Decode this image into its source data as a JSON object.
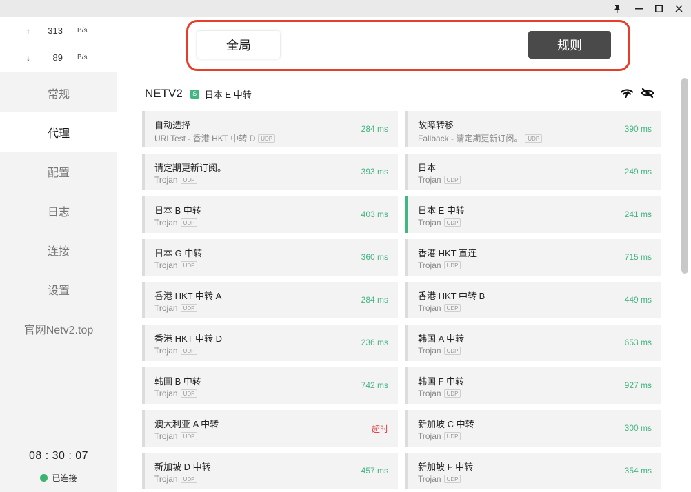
{
  "window": {
    "controls": [
      "pin-icon",
      "minimize-icon",
      "maximize-icon",
      "close-icon"
    ]
  },
  "traffic": {
    "up_arrow": "↑",
    "up_value": "313",
    "up_unit": "B/s",
    "down_arrow": "↓",
    "down_value": "89",
    "down_unit": "B/s"
  },
  "nav": {
    "items": [
      {
        "label": "常规"
      },
      {
        "label": "代理"
      },
      {
        "label": "配置"
      },
      {
        "label": "日志"
      },
      {
        "label": "连接"
      },
      {
        "label": "设置"
      },
      {
        "label": "官网Netv2.top"
      }
    ],
    "active_index": 1
  },
  "clock": "08 : 30 : 07",
  "connection_status": "已连接",
  "mode": {
    "global_label": "全局",
    "rule_label": "规则",
    "active": "rule"
  },
  "group": {
    "name": "NETV2",
    "badge": "S",
    "selected": "日本 E 中转",
    "icons": [
      "speed-test-icon",
      "hide-icon"
    ]
  },
  "colors": {
    "accent": "#43b581",
    "timeout": "#e03030",
    "highlight_border": "#e53e2b",
    "rule_button": "#4a4a4a"
  },
  "proxies": [
    {
      "name": "自动选择",
      "type": "URLTest - 香港 HKT 中转 D",
      "tag": "UDP",
      "delay": "284 ms"
    },
    {
      "name": "故障转移",
      "type": "Fallback - 请定期更新订阅。",
      "tag": "UDP",
      "delay": "390 ms"
    },
    {
      "name": "请定期更新订阅。",
      "type": "Trojan",
      "tag": "UDP",
      "delay": "393 ms"
    },
    {
      "name": "日本",
      "type": "Trojan",
      "tag": "UDP",
      "delay": "249 ms"
    },
    {
      "name": "日本 B 中转",
      "type": "Trojan",
      "tag": "UDP",
      "delay": "403 ms"
    },
    {
      "name": "日本 E 中转",
      "type": "Trojan",
      "tag": "UDP",
      "delay": "241 ms",
      "selected": true
    },
    {
      "name": "日本 G 中转",
      "type": "Trojan",
      "tag": "UDP",
      "delay": "360 ms"
    },
    {
      "name": "香港 HKT 直连",
      "type": "Trojan",
      "tag": "UDP",
      "delay": "715 ms"
    },
    {
      "name": "香港 HKT 中转 A",
      "type": "Trojan",
      "tag": "UDP",
      "delay": "284 ms"
    },
    {
      "name": "香港 HKT 中转 B",
      "type": "Trojan",
      "tag": "UDP",
      "delay": "449 ms"
    },
    {
      "name": "香港 HKT 中转 D",
      "type": "Trojan",
      "tag": "UDP",
      "delay": "236 ms"
    },
    {
      "name": "韩国 A 中转",
      "type": "Trojan",
      "tag": "UDP",
      "delay": "653 ms"
    },
    {
      "name": "韩国 B 中转",
      "type": "Trojan",
      "tag": "UDP",
      "delay": "742 ms"
    },
    {
      "name": "韩国 F 中转",
      "type": "Trojan",
      "tag": "UDP",
      "delay": "927 ms"
    },
    {
      "name": "澳大利亚 A 中转",
      "type": "Trojan",
      "tag": "UDP",
      "delay": "超时",
      "timeout": true
    },
    {
      "name": "新加坡 C 中转",
      "type": "Trojan",
      "tag": "UDP",
      "delay": "300 ms"
    },
    {
      "name": "新加坡 D 中转",
      "type": "Trojan",
      "tag": "UDP",
      "delay": "457 ms"
    },
    {
      "name": "新加坡 F 中转",
      "type": "Trojan",
      "tag": "UDP",
      "delay": "354 ms"
    }
  ]
}
